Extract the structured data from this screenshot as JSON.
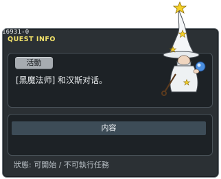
{
  "quest": {
    "id": "16931-0",
    "header": "QUEST INFO",
    "tag": "活動",
    "description": "[黑魔法师] 和汉斯对话。",
    "content_label": "内容",
    "status": "狀態:  可開始 / 不可執行任務"
  },
  "colors": {
    "window_bg": "#2b3034",
    "panel_bg": "#1d2226",
    "header_text": "#f2e26a",
    "tag_bg": "#a7acb1",
    "content_bar": "#3d4c57"
  },
  "icons": {
    "npc": "wizard-npc-icon"
  }
}
